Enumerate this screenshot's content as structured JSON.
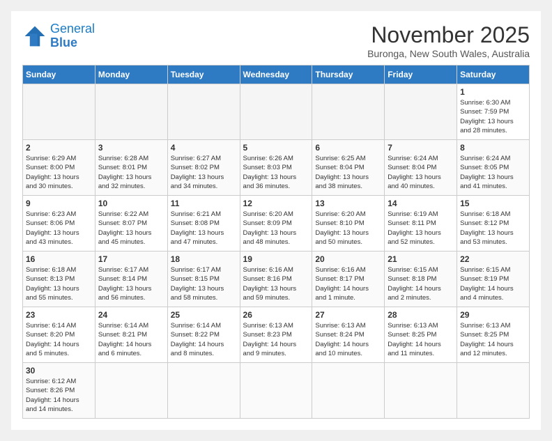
{
  "header": {
    "logo_general": "General",
    "logo_blue": "Blue",
    "title": "November 2025",
    "location": "Buronga, New South Wales, Australia"
  },
  "weekdays": [
    "Sunday",
    "Monday",
    "Tuesday",
    "Wednesday",
    "Thursday",
    "Friday",
    "Saturday"
  ],
  "weeks": [
    [
      {
        "day": "",
        "info": ""
      },
      {
        "day": "",
        "info": ""
      },
      {
        "day": "",
        "info": ""
      },
      {
        "day": "",
        "info": ""
      },
      {
        "day": "",
        "info": ""
      },
      {
        "day": "",
        "info": ""
      },
      {
        "day": "1",
        "info": "Sunrise: 6:30 AM\nSunset: 7:59 PM\nDaylight: 13 hours\nand 28 minutes."
      }
    ],
    [
      {
        "day": "2",
        "info": "Sunrise: 6:29 AM\nSunset: 8:00 PM\nDaylight: 13 hours\nand 30 minutes."
      },
      {
        "day": "3",
        "info": "Sunrise: 6:28 AM\nSunset: 8:01 PM\nDaylight: 13 hours\nand 32 minutes."
      },
      {
        "day": "4",
        "info": "Sunrise: 6:27 AM\nSunset: 8:02 PM\nDaylight: 13 hours\nand 34 minutes."
      },
      {
        "day": "5",
        "info": "Sunrise: 6:26 AM\nSunset: 8:03 PM\nDaylight: 13 hours\nand 36 minutes."
      },
      {
        "day": "6",
        "info": "Sunrise: 6:25 AM\nSunset: 8:04 PM\nDaylight: 13 hours\nand 38 minutes."
      },
      {
        "day": "7",
        "info": "Sunrise: 6:24 AM\nSunset: 8:04 PM\nDaylight: 13 hours\nand 40 minutes."
      },
      {
        "day": "8",
        "info": "Sunrise: 6:24 AM\nSunset: 8:05 PM\nDaylight: 13 hours\nand 41 minutes."
      }
    ],
    [
      {
        "day": "9",
        "info": "Sunrise: 6:23 AM\nSunset: 8:06 PM\nDaylight: 13 hours\nand 43 minutes."
      },
      {
        "day": "10",
        "info": "Sunrise: 6:22 AM\nSunset: 8:07 PM\nDaylight: 13 hours\nand 45 minutes."
      },
      {
        "day": "11",
        "info": "Sunrise: 6:21 AM\nSunset: 8:08 PM\nDaylight: 13 hours\nand 47 minutes."
      },
      {
        "day": "12",
        "info": "Sunrise: 6:20 AM\nSunset: 8:09 PM\nDaylight: 13 hours\nand 48 minutes."
      },
      {
        "day": "13",
        "info": "Sunrise: 6:20 AM\nSunset: 8:10 PM\nDaylight: 13 hours\nand 50 minutes."
      },
      {
        "day": "14",
        "info": "Sunrise: 6:19 AM\nSunset: 8:11 PM\nDaylight: 13 hours\nand 52 minutes."
      },
      {
        "day": "15",
        "info": "Sunrise: 6:18 AM\nSunset: 8:12 PM\nDaylight: 13 hours\nand 53 minutes."
      }
    ],
    [
      {
        "day": "16",
        "info": "Sunrise: 6:18 AM\nSunset: 8:13 PM\nDaylight: 13 hours\nand 55 minutes."
      },
      {
        "day": "17",
        "info": "Sunrise: 6:17 AM\nSunset: 8:14 PM\nDaylight: 13 hours\nand 56 minutes."
      },
      {
        "day": "18",
        "info": "Sunrise: 6:17 AM\nSunset: 8:15 PM\nDaylight: 13 hours\nand 58 minutes."
      },
      {
        "day": "19",
        "info": "Sunrise: 6:16 AM\nSunset: 8:16 PM\nDaylight: 13 hours\nand 59 minutes."
      },
      {
        "day": "20",
        "info": "Sunrise: 6:16 AM\nSunset: 8:17 PM\nDaylight: 14 hours\nand 1 minute."
      },
      {
        "day": "21",
        "info": "Sunrise: 6:15 AM\nSunset: 8:18 PM\nDaylight: 14 hours\nand 2 minutes."
      },
      {
        "day": "22",
        "info": "Sunrise: 6:15 AM\nSunset: 8:19 PM\nDaylight: 14 hours\nand 4 minutes."
      }
    ],
    [
      {
        "day": "23",
        "info": "Sunrise: 6:14 AM\nSunset: 8:20 PM\nDaylight: 14 hours\nand 5 minutes."
      },
      {
        "day": "24",
        "info": "Sunrise: 6:14 AM\nSunset: 8:21 PM\nDaylight: 14 hours\nand 6 minutes."
      },
      {
        "day": "25",
        "info": "Sunrise: 6:14 AM\nSunset: 8:22 PM\nDaylight: 14 hours\nand 8 minutes."
      },
      {
        "day": "26",
        "info": "Sunrise: 6:13 AM\nSunset: 8:23 PM\nDaylight: 14 hours\nand 9 minutes."
      },
      {
        "day": "27",
        "info": "Sunrise: 6:13 AM\nSunset: 8:24 PM\nDaylight: 14 hours\nand 10 minutes."
      },
      {
        "day": "28",
        "info": "Sunrise: 6:13 AM\nSunset: 8:25 PM\nDaylight: 14 hours\nand 11 minutes."
      },
      {
        "day": "29",
        "info": "Sunrise: 6:13 AM\nSunset: 8:25 PM\nDaylight: 14 hours\nand 12 minutes."
      }
    ],
    [
      {
        "day": "30",
        "info": "Sunrise: 6:12 AM\nSunset: 8:26 PM\nDaylight: 14 hours\nand 14 minutes."
      },
      {
        "day": "",
        "info": ""
      },
      {
        "day": "",
        "info": ""
      },
      {
        "day": "",
        "info": ""
      },
      {
        "day": "",
        "info": ""
      },
      {
        "day": "",
        "info": ""
      },
      {
        "day": "",
        "info": ""
      }
    ]
  ]
}
